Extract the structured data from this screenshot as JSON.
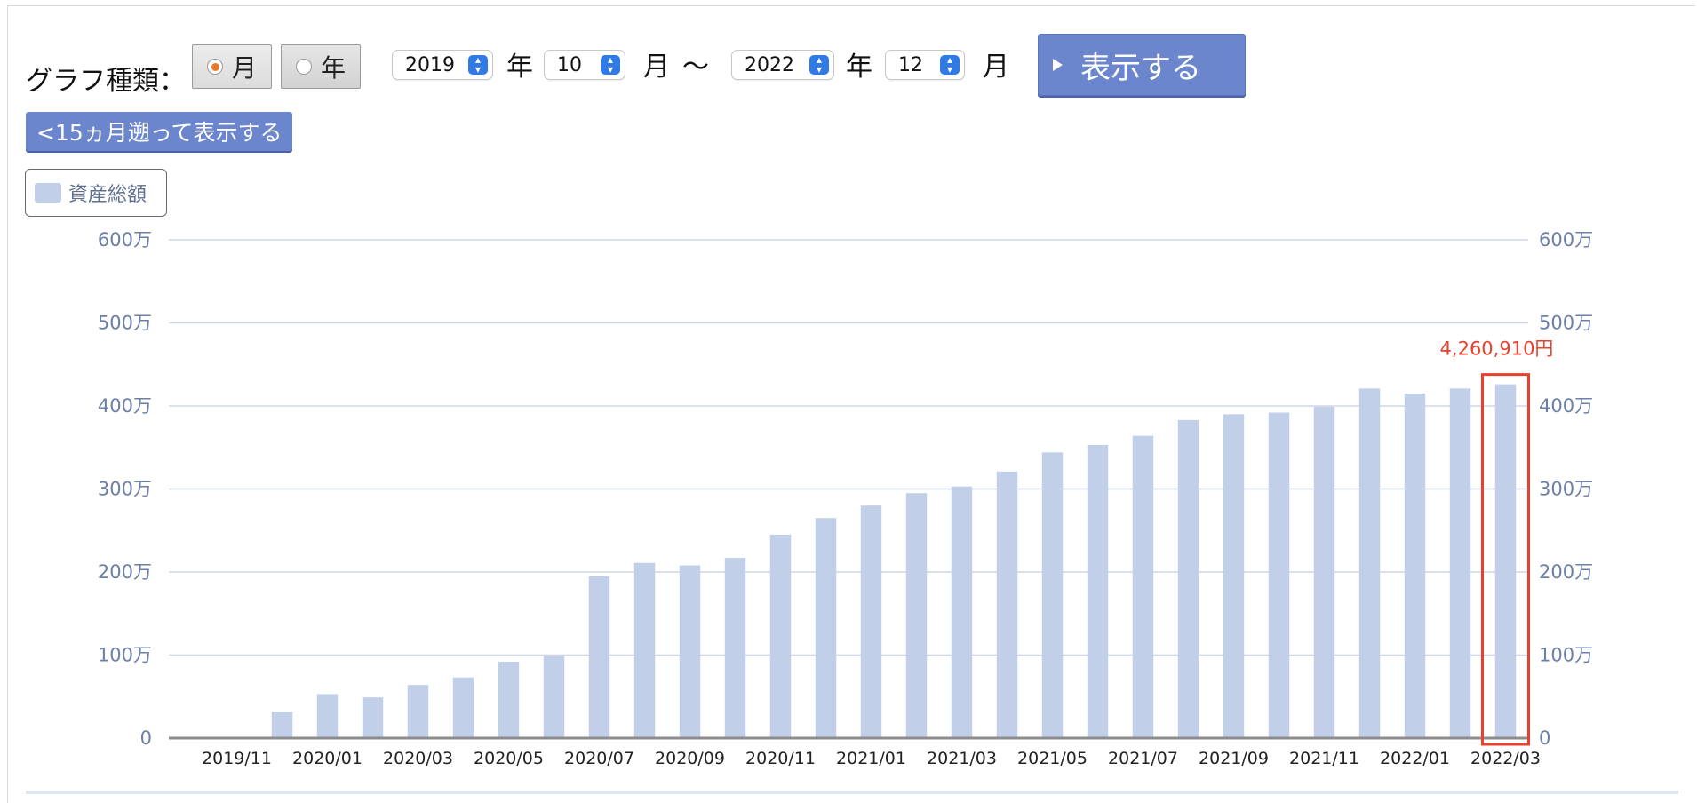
{
  "controls": {
    "graph_type_label": "グラフ種類：",
    "radio_month": "月",
    "radio_year": "年",
    "start_year": "2019",
    "start_year_unit": "年",
    "start_month": "10",
    "start_month_unit": "月",
    "range_sep": "〜",
    "end_year": "2022",
    "end_year_unit": "年",
    "end_month": "12",
    "end_month_unit": "月",
    "show_button": "表示する",
    "back_button": "<15ヵ月遡って表示する"
  },
  "legend": {
    "label": "資産総額",
    "color": "#c2cfe8"
  },
  "colors": {
    "bar": "#c2cfe8",
    "highlight": "#e8412f",
    "grid": "#cfd6e3",
    "axis": "#8c8c8c",
    "tick": "#6b7fa8",
    "button": "#6b86cc"
  },
  "chart_data": {
    "type": "bar",
    "series": [
      {
        "name": "資産総額",
        "unit": "万",
        "values": [
          0,
          0,
          32,
          53,
          49,
          64,
          73,
          92,
          99,
          195,
          211,
          208,
          217,
          245,
          265,
          280,
          295,
          303,
          321,
          344,
          353,
          364,
          383,
          390,
          392,
          399,
          421,
          415,
          421,
          426.091
        ]
      }
    ],
    "categories": [
      "2019/10",
      "2019/11",
      "2019/12",
      "2020/01",
      "2020/02",
      "2020/03",
      "2020/04",
      "2020/05",
      "2020/06",
      "2020/07",
      "2020/08",
      "2020/09",
      "2020/10",
      "2020/11",
      "2020/12",
      "2021/01",
      "2021/02",
      "2021/03",
      "2021/04",
      "2021/05",
      "2021/06",
      "2021/07",
      "2021/08",
      "2021/09",
      "2021/10",
      "2021/11",
      "2021/12",
      "2022/01",
      "2022/02",
      "2022/03"
    ],
    "x_tick_labels": [
      "2019/11",
      "2020/01",
      "2020/03",
      "2020/05",
      "2020/07",
      "2020/09",
      "2020/11",
      "2021/01",
      "2021/03",
      "2021/05",
      "2021/07",
      "2021/09",
      "2021/11",
      "2022/01",
      "2022/03"
    ],
    "y_ticks": [
      "0",
      "100万",
      "200万",
      "300万",
      "400万",
      "500万",
      "600万"
    ],
    "ylim": [
      0,
      600
    ],
    "grid": true,
    "legend_position": "top-left",
    "highlight_label": "4,260,910円",
    "highlight_category": "2022/03"
  }
}
